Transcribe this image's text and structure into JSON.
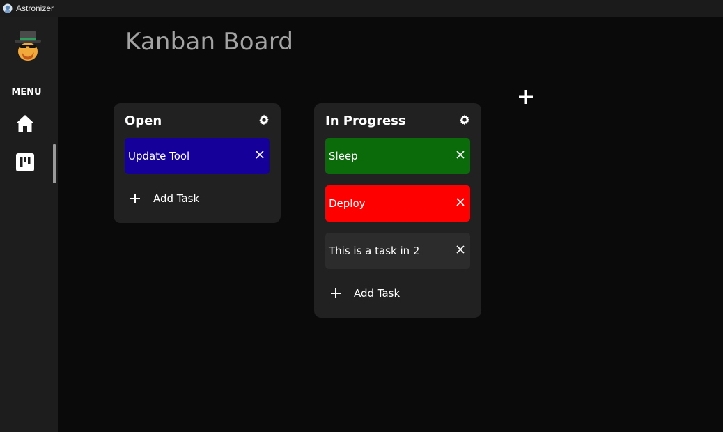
{
  "window": {
    "title": "Astronizer"
  },
  "sidebar": {
    "menu_label": "MENU",
    "items": [
      {
        "name": "home",
        "icon": "home-icon"
      },
      {
        "name": "board",
        "icon": "kanban-board-icon",
        "active": true
      }
    ]
  },
  "page": {
    "title": "Kanban Board"
  },
  "columns": [
    {
      "title": "Open",
      "tasks": [
        {
          "text": "Update Tool",
          "color": "#15009a"
        }
      ],
      "add_label": "Add Task"
    },
    {
      "title": "In Progress",
      "tasks": [
        {
          "text": "Sleep",
          "color": "#0b6b0b"
        },
        {
          "text": "Deploy",
          "color": "#ff0000"
        },
        {
          "text": "This is a task in 2",
          "color": "#2c2c2c"
        }
      ],
      "add_label": "Add Task"
    }
  ],
  "colors": {
    "background": "#0a0a0a",
    "sidebar": "#1d1d1d",
    "column": "#212121",
    "title_text": "#a3a3a3"
  }
}
